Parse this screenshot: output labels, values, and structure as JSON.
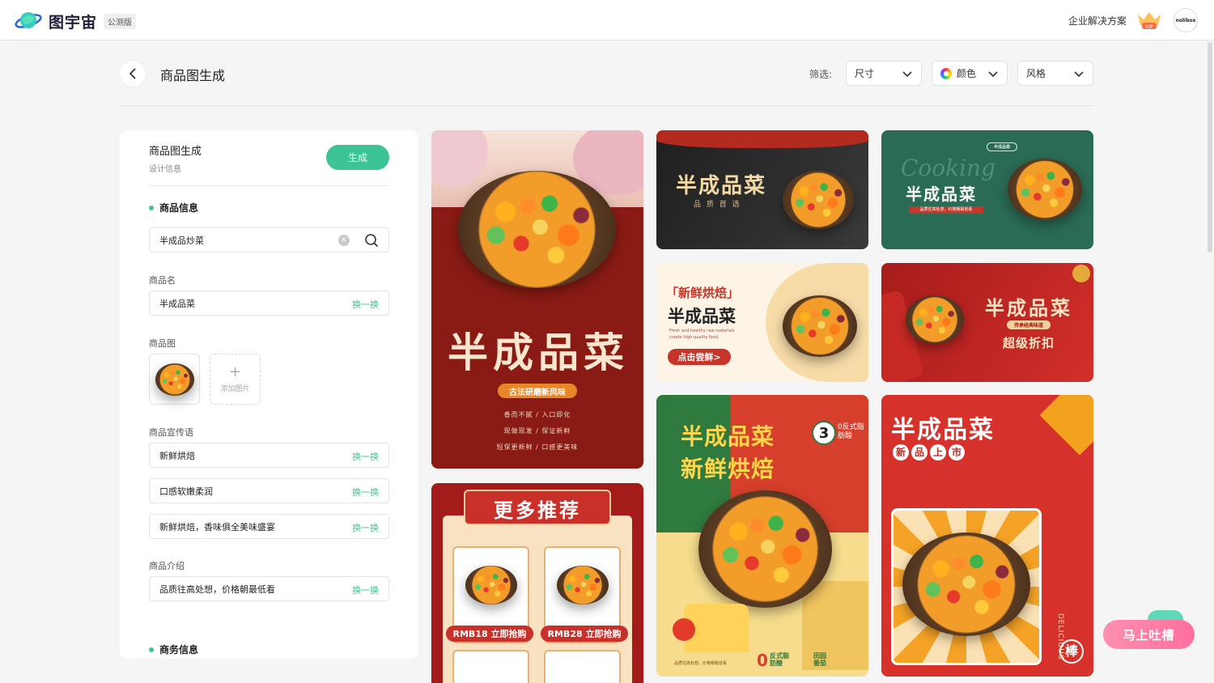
{
  "topbar": {
    "brand": "图宇宙",
    "beta": "公测版",
    "enterprise": "企业解决方案",
    "vip_label": "VIP",
    "avatar_text": "nolibox"
  },
  "header": {
    "title": "商品图生成",
    "filter_label": "筛选:",
    "filters": {
      "size": "尺寸",
      "color": "颜色",
      "style": "风格"
    }
  },
  "panel": {
    "title": "商品图生成",
    "subtitle": "设计信息",
    "generate": "生成",
    "section_product": "商品信息",
    "search_value": "半成品炒菜",
    "name_label": "商品名",
    "name_value": "半成品菜",
    "image_label": "商品图",
    "add_image": "添加图片",
    "slogan_label": "商品宣传语",
    "slogans": [
      "新鲜烘焙",
      "口感软嫩柔润",
      "新鲜烘焙，香味俱全美味盛宴"
    ],
    "intro_label": "商品介绍",
    "intro_value": "品质往高处想，价格朝最低看",
    "section_business": "商务信息",
    "swap": "换一换"
  },
  "cards": {
    "c1": {
      "title": "半成品菜",
      "pill": "古法研磨新风味",
      "lines": [
        "香而不腻 / 入口即化",
        "现做现发 / 保证新鲜",
        "短保更新鲜 / 口感更美味"
      ]
    },
    "c2": {
      "title": "半成品菜",
      "sub": "品 质 首 选"
    },
    "c3": {
      "script": "Cooking",
      "badge": "半成品菜",
      "title": "半成品菜",
      "tagline": "品质往高处想，价格朝最低看"
    },
    "c4": {
      "quote": "「新鲜烘焙」",
      "title": "半成品菜",
      "en1": "Fresh and healthy raw materials",
      "en2": "create high-quality food.",
      "cta": "点击尝鲜>"
    },
    "c5": {
      "title": "半成品菜",
      "pill": "传承经典味道",
      "sub": "超级折扣"
    },
    "c6": {
      "title": "更多推荐",
      "price1": "RMB18 立即抢购",
      "price2": "RMB28 立即抢购"
    },
    "c7": {
      "title1": "半成品菜",
      "title2": "新鲜烘焙",
      "num": "3",
      "badge": "0反式脂肪酸",
      "foot1": "0",
      "foot2": "反式脂肪酸",
      "foot3": "田园番茄",
      "tiny": "品质往高处想，价格朝最低看"
    },
    "c8": {
      "title": "半成品菜",
      "tags": [
        "新",
        "品",
        "上",
        "市"
      ],
      "side": "DELICIOUS",
      "seal": "棒"
    }
  },
  "feedback": "马上吐槽",
  "colors": {
    "accent": "#3cc497",
    "red": "#b8211f",
    "dark_green": "#2a6b55"
  }
}
